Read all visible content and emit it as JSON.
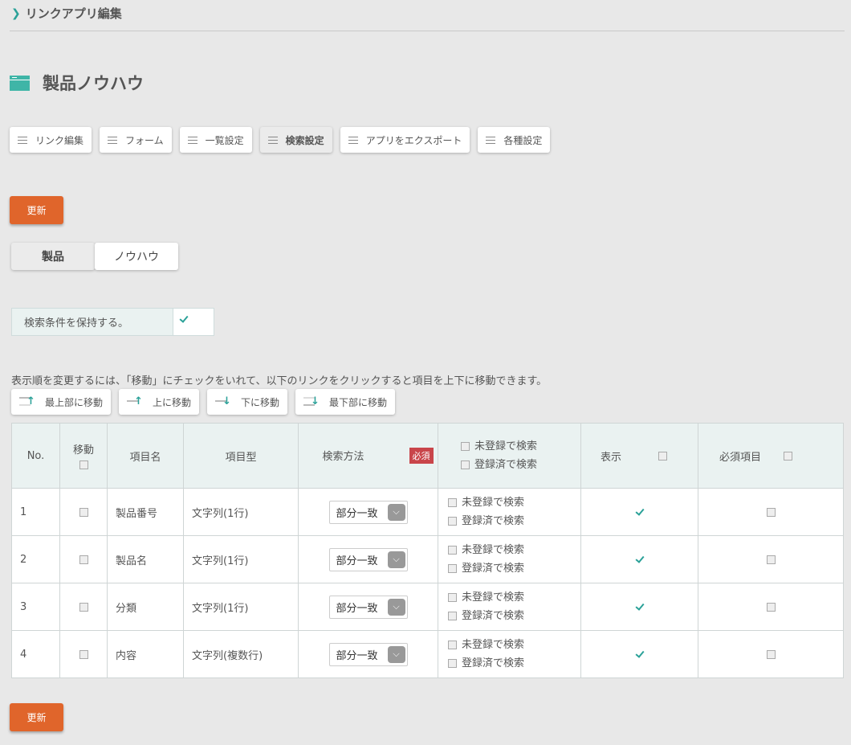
{
  "breadcrumb": {
    "label": "リンクアプリ編集"
  },
  "page": {
    "title": "製品ノウハウ"
  },
  "tabs": [
    {
      "label": "リンク編集"
    },
    {
      "label": "フォーム"
    },
    {
      "label": "一覧設定"
    },
    {
      "label": "検索設定"
    },
    {
      "label": "アプリをエクスポート"
    },
    {
      "label": "各種設定"
    }
  ],
  "update_label": "更新",
  "subtabs": [
    {
      "label": "製品"
    },
    {
      "label": "ノウハウ"
    }
  ],
  "keep_search": {
    "label": "検索条件を保持する。",
    "checked": true
  },
  "note": "表示順を変更するには、「移動」にチェックをいれて、以下のリンクをクリックすると項目を上下に移動できます。",
  "move_buttons": [
    {
      "label": "最上部に移動"
    },
    {
      "label": "上に移動"
    },
    {
      "label": "下に移動"
    },
    {
      "label": "最下部に移動"
    }
  ],
  "table": {
    "headers": {
      "no": "No.",
      "move": "移動",
      "name": "項目名",
      "type": "項目型",
      "method": "検索方法",
      "required_badge": "必須",
      "unregistered": "未登録で検索",
      "registered": "登録済で検索",
      "display": "表示",
      "required": "必須項目"
    },
    "rows": [
      {
        "no": "1",
        "name": "製品番号",
        "type": "文字列(1行)",
        "method": "部分一致",
        "opt1": "未登録で検索",
        "opt2": "登録済で検索",
        "display": true,
        "required": false
      },
      {
        "no": "2",
        "name": "製品名",
        "type": "文字列(1行)",
        "method": "部分一致",
        "opt1": "未登録で検索",
        "opt2": "登録済で検索",
        "display": true,
        "required": false
      },
      {
        "no": "3",
        "name": "分類",
        "type": "文字列(1行)",
        "method": "部分一致",
        "opt1": "未登録で検索",
        "opt2": "登録済で検索",
        "display": true,
        "required": false
      },
      {
        "no": "4",
        "name": "内容",
        "type": "文字列(複数行)",
        "method": "部分一致",
        "opt1": "未登録で検索",
        "opt2": "登録済で検索",
        "display": true,
        "required": false
      }
    ]
  }
}
